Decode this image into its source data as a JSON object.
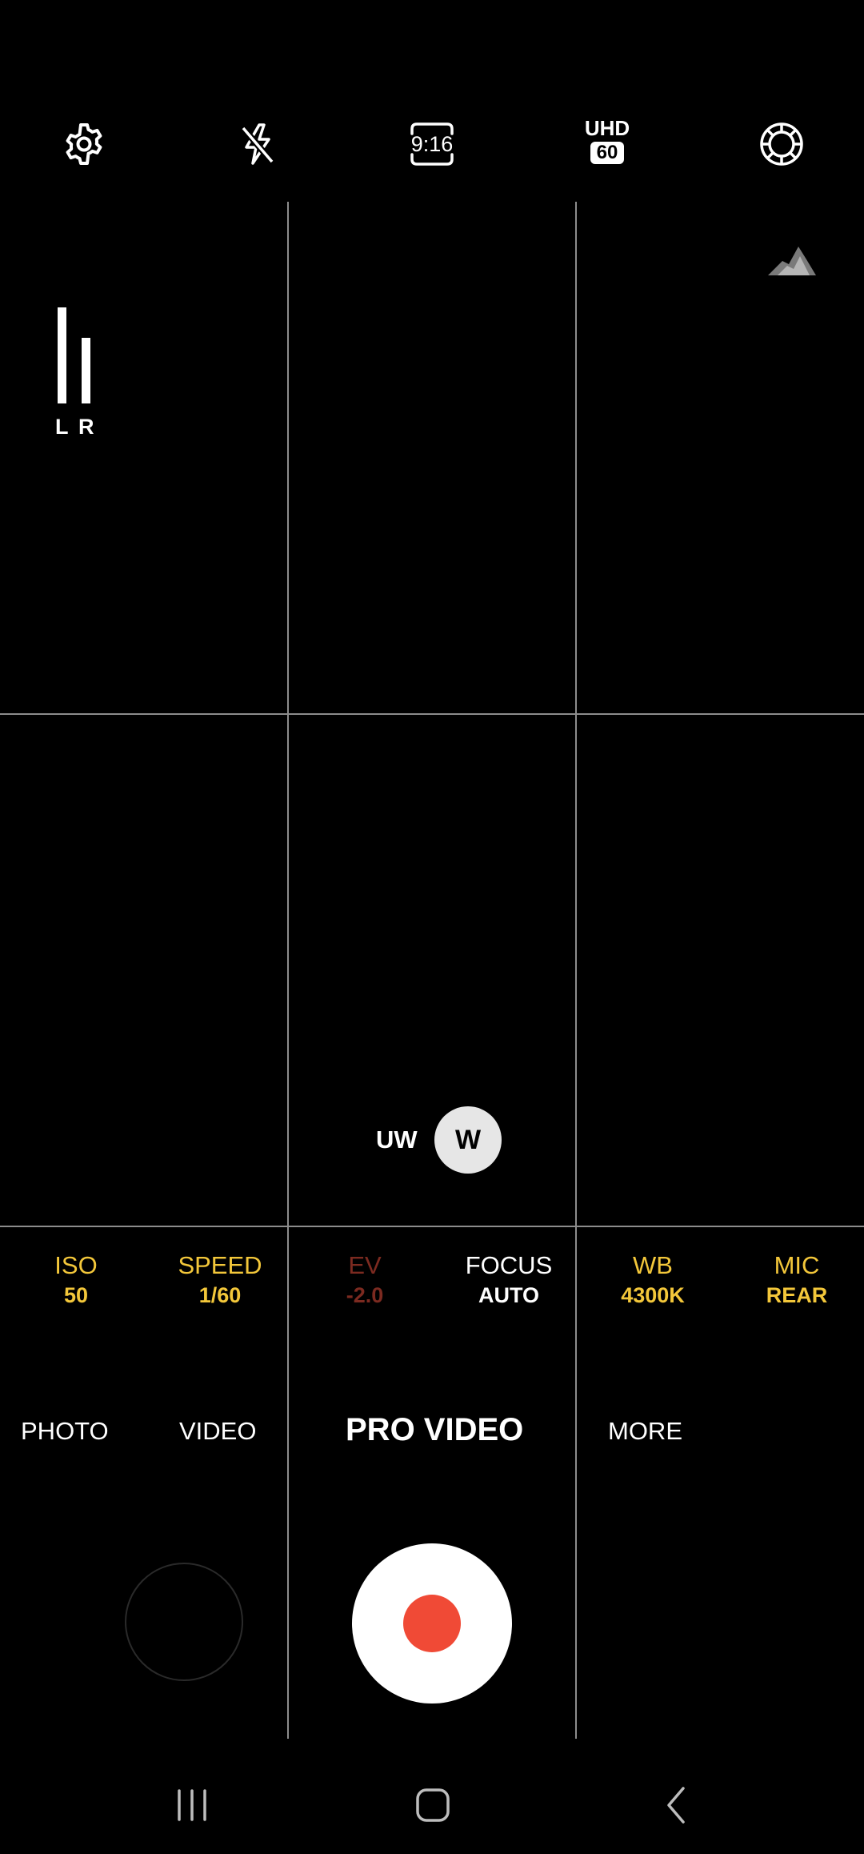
{
  "top_bar": {
    "icons": [
      "gear-icon",
      "flash-off-icon",
      "aspect-ratio-icon",
      "resolution-badge",
      "lens-ring-icon"
    ],
    "aspect_ratio": "9:16",
    "resolution": "UHD",
    "fps": "60"
  },
  "audio_meter": {
    "left_label": "L",
    "right_label": "R"
  },
  "histogram_icon": "histogram-icon",
  "zoom": {
    "options": [
      {
        "label": "UW",
        "selected": false
      },
      {
        "label": "W",
        "selected": true
      }
    ]
  },
  "pro_settings": [
    {
      "name": "ISO",
      "value": "50",
      "color": "#f3c73a"
    },
    {
      "name": "SPEED",
      "value": "1/60",
      "color": "#f3c73a"
    },
    {
      "name": "EV",
      "value": "-2.0",
      "color": "#7c2a20"
    },
    {
      "name": "FOCUS",
      "value": "AUTO",
      "color": "#ffffff"
    },
    {
      "name": "WB",
      "value": "4300K",
      "color": "#f3c73a"
    },
    {
      "name": "MIC",
      "value": "REAR",
      "color": "#f3c73a"
    }
  ],
  "modes": {
    "photo": "PHOTO",
    "video": "VIDEO",
    "active": "PRO VIDEO",
    "more": "MORE"
  },
  "shutter": {
    "record_color": "#f04a36"
  },
  "nav_bar": {
    "icons": [
      "recent-apps-icon",
      "home-icon",
      "back-icon"
    ]
  }
}
